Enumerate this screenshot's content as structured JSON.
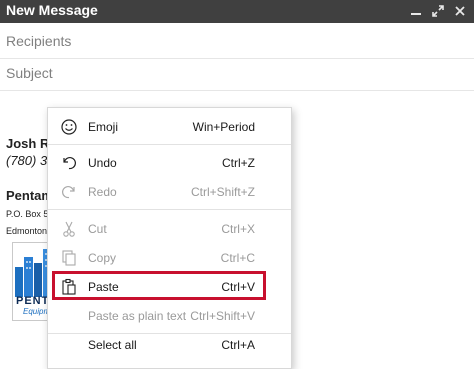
{
  "window": {
    "title": "New Message"
  },
  "compose": {
    "recipients_placeholder": "Recipients",
    "subject_placeholder": "Subject"
  },
  "signature": {
    "name": "Josh Ra",
    "phone": "(780) 39",
    "company": "Pentam",
    "address1": "P.O. Box 5",
    "address2": "Edmonton",
    "logo_text": "PENT",
    "logo_subtext": "Equipm"
  },
  "context_menu": {
    "items": [
      {
        "label": "Emoji",
        "shortcut": "Win+Period",
        "enabled": true,
        "icon": "smiley-icon"
      },
      {
        "label": "Undo",
        "shortcut": "Ctrl+Z",
        "enabled": true,
        "icon": "undo-icon"
      },
      {
        "label": "Redo",
        "shortcut": "Ctrl+Shift+Z",
        "enabled": false,
        "icon": "redo-icon"
      },
      {
        "label": "Cut",
        "shortcut": "Ctrl+X",
        "enabled": false,
        "icon": "scissors-icon"
      },
      {
        "label": "Copy",
        "shortcut": "Ctrl+C",
        "enabled": false,
        "icon": "copy-icon"
      },
      {
        "label": "Paste",
        "shortcut": "Ctrl+V",
        "enabled": true,
        "icon": "clipboard-icon",
        "highlighted": true
      },
      {
        "label": "Paste as plain text",
        "shortcut": "Ctrl+Shift+V",
        "enabled": false
      },
      {
        "label": "Select all",
        "shortcut": "Ctrl+A",
        "enabled": true
      }
    ]
  },
  "colors": {
    "titlebar_bg": "#404040",
    "highlight_border": "#c8102e",
    "disabled_text": "#9a9a9a"
  }
}
